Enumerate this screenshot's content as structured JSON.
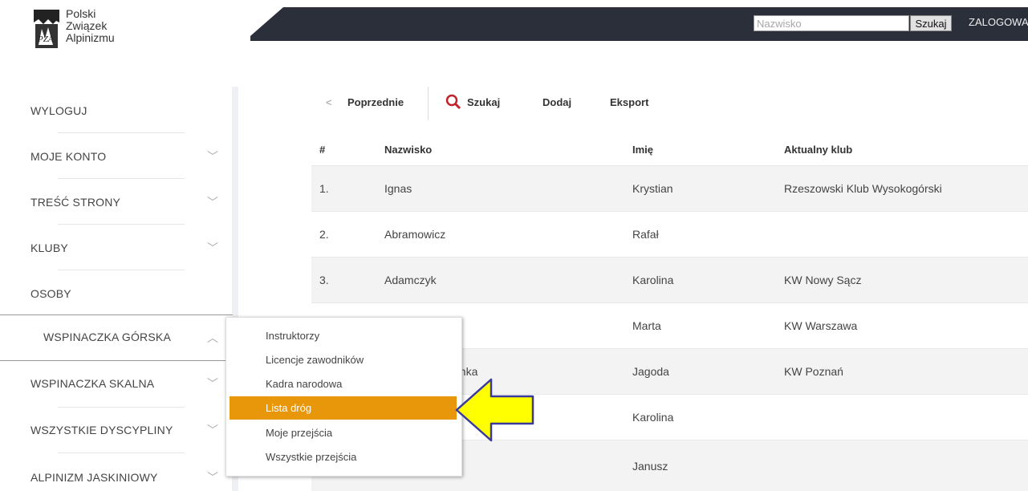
{
  "logo": {
    "lines": [
      "Polski",
      "Związek",
      "Alpinizmu"
    ]
  },
  "header": {
    "search_placeholder": "Nazwisko",
    "search_button": "Szukaj",
    "login_label": "ZALOGOWA"
  },
  "sidebar": {
    "items": [
      {
        "label": "WYLOGUJ"
      },
      {
        "label": "MOJE KONTO",
        "chevron": "chevron-down-icon"
      },
      {
        "label": "TREŚĆ STRONY",
        "chevron": "chevron-down-icon"
      },
      {
        "label": "KLUBY",
        "chevron": "chevron-down-icon"
      },
      {
        "label": "OSOBY"
      },
      {
        "label": "WSPINACZKA GÓRSKA",
        "chevron": "chevron-up-icon"
      },
      {
        "label": "WSPINACZKA SKALNA",
        "chevron": "chevron-down-icon"
      },
      {
        "label": "WSZYSTKIE DYSCYPLINY",
        "chevron": "chevron-down-icon"
      },
      {
        "label": "ALPINIZM JASKINIOWY",
        "chevron": "chevron-down-icon"
      }
    ]
  },
  "toolbar": {
    "prev_label": "Poprzednie",
    "search_label": "Szukaj",
    "add_label": "Dodaj",
    "export_label": "Eksport"
  },
  "table": {
    "columns": [
      "#",
      "Nazwisko",
      "Imię",
      "Aktualny klub"
    ],
    "rows": [
      {
        "num": "1.",
        "surname": "Ignas",
        "name": "Krystian",
        "club": "Rzeszowski Klub Wysokogórski"
      },
      {
        "num": "2.",
        "surname": "Abramowicz",
        "name": "Rafał",
        "club": ""
      },
      {
        "num": "3.",
        "surname": "Adamczyk",
        "name": "Karolina",
        "club": "KW Nowy Sącz"
      },
      {
        "num": "",
        "surname": "",
        "name": "Marta",
        "club": "KW Warszawa"
      },
      {
        "num": "",
        "surname": "anka",
        "name": "Jagoda",
        "club": "KW Poznań"
      },
      {
        "num": "",
        "surname": "",
        "name": "Karolina",
        "club": ""
      },
      {
        "num": "",
        "surname": "",
        "name": "Janusz",
        "club": ""
      }
    ]
  },
  "dropdown": {
    "items": [
      {
        "label": "Instruktorzy"
      },
      {
        "label": "Licencje zawodników"
      },
      {
        "label": "Kadra narodowa"
      },
      {
        "label": "Lista dróg",
        "active": true
      },
      {
        "label": "Moje przejścia"
      },
      {
        "label": "Wszystkie przejścia"
      }
    ]
  },
  "colors": {
    "topbar": "#2b2f39",
    "accent": "#e8960a",
    "search_icon": "#c0232c",
    "arrow": "#ffff00"
  }
}
